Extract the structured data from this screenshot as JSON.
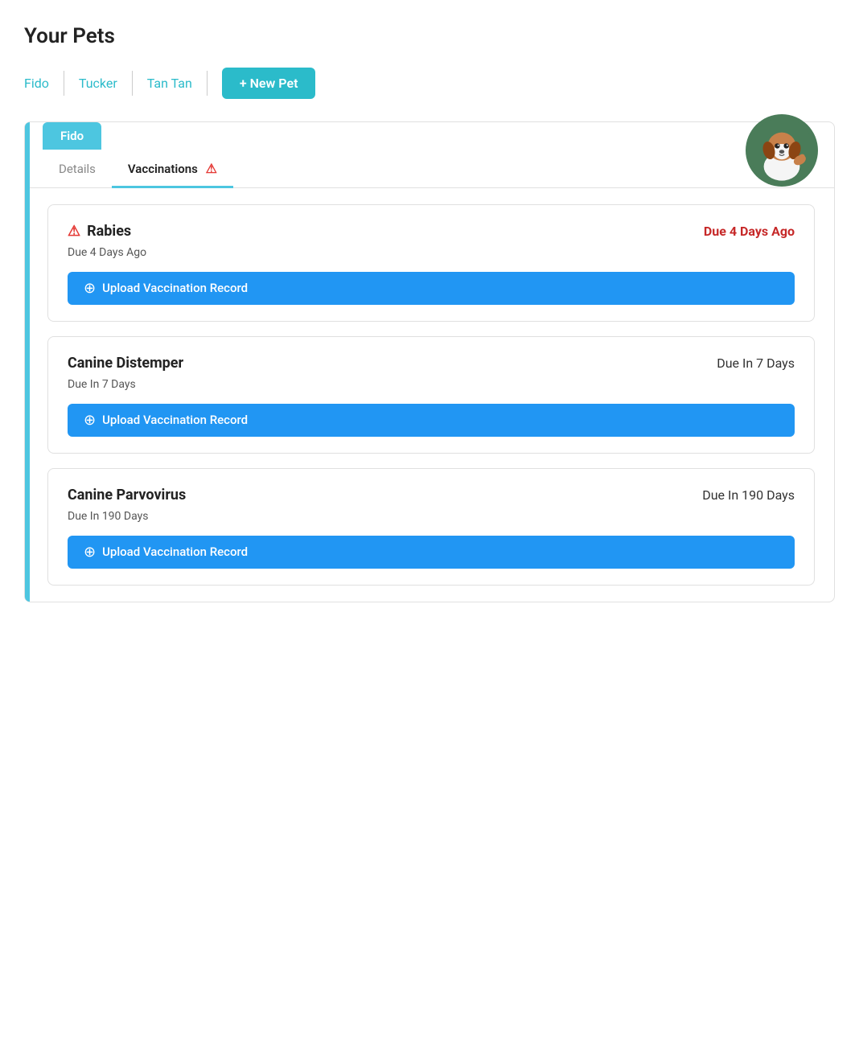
{
  "page": {
    "title": "Your Pets"
  },
  "pets_tabs": [
    {
      "id": "fido",
      "label": "Fido",
      "active": true
    },
    {
      "id": "tucker",
      "label": "Tucker",
      "active": false
    },
    {
      "id": "tantan",
      "label": "Tan Tan",
      "active": false
    }
  ],
  "new_pet_button": "+ New Pet",
  "active_pet": {
    "name": "Fido",
    "tabs": [
      {
        "id": "details",
        "label": "Details",
        "active": false,
        "warning": false
      },
      {
        "id": "vaccinations",
        "label": "Vaccinations",
        "active": true,
        "warning": true
      }
    ],
    "vaccinations": [
      {
        "id": "rabies",
        "name": "Rabies",
        "overdue": true,
        "warning_icon": "⚠",
        "due_label": "Due 4 Days Ago",
        "due_label_overdue": "Due 4 Days Ago",
        "upload_label": "Upload Vaccination Record"
      },
      {
        "id": "canine-distemper",
        "name": "Canine Distemper",
        "overdue": false,
        "warning_icon": null,
        "due_label": "Due In 7 Days",
        "due_label_overdue": null,
        "upload_label": "Upload Vaccination Record"
      },
      {
        "id": "canine-parvovirus",
        "name": "Canine Parvovirus",
        "overdue": false,
        "warning_icon": null,
        "due_label": "Due In 190 Days",
        "due_label_overdue": null,
        "upload_label": "Upload Vaccination Record"
      }
    ]
  },
  "colors": {
    "accent_teal": "#4dc6e0",
    "teal_btn": "#2bbbca",
    "overdue_red": "#c62828",
    "upload_blue": "#2196f3"
  }
}
